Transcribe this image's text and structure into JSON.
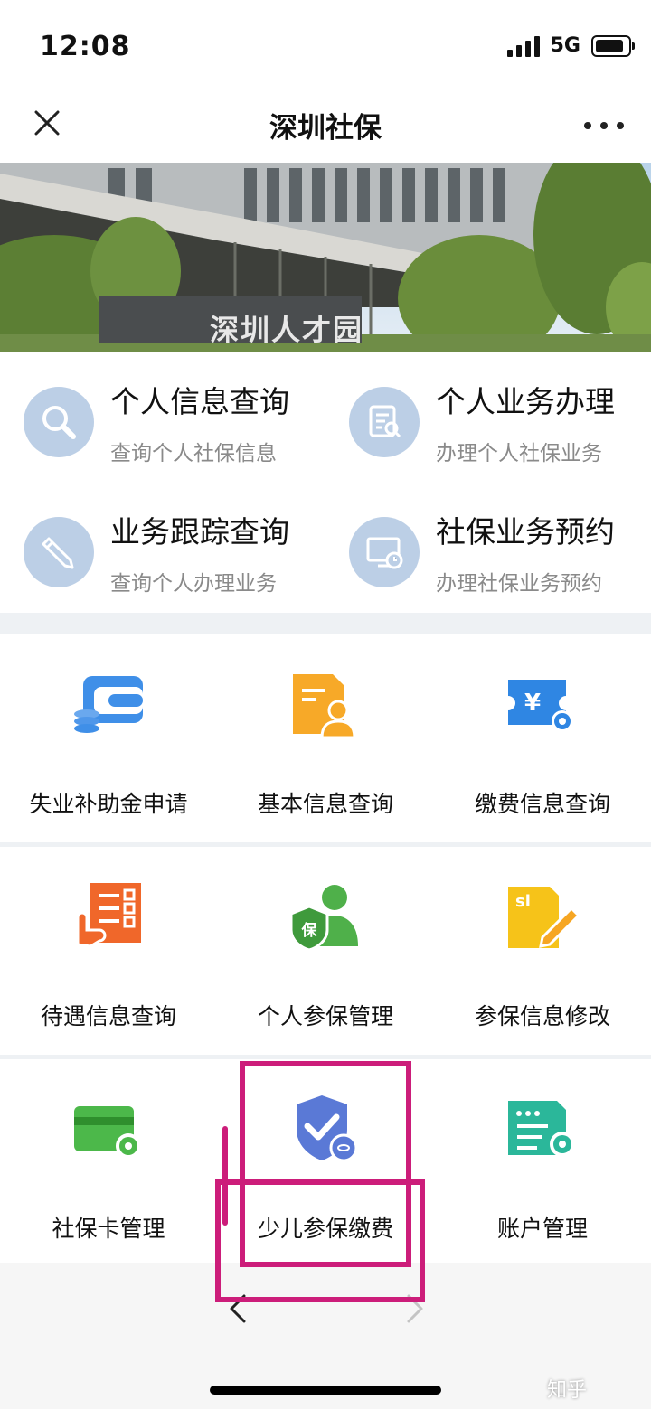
{
  "status": {
    "time": "12:08",
    "network": "5G"
  },
  "nav": {
    "title": "深圳社保",
    "close_icon": "close-icon",
    "more_icon": "more-dots-icon"
  },
  "banner": {
    "sign_text": "深圳人才园"
  },
  "quick_actions": [
    {
      "title": "个人信息查询",
      "subtitle": "查询个人社保信息",
      "icon": "search-icon"
    },
    {
      "title": "个人业务办理",
      "subtitle": "办理个人社保业务",
      "icon": "document-search-icon"
    },
    {
      "title": "业务跟踪查询",
      "subtitle": "查询个人办理业务",
      "icon": "pencil-icon"
    },
    {
      "title": "社保业务预约",
      "subtitle": "办理社保业务预约",
      "icon": "monitor-clock-icon"
    }
  ],
  "services": [
    {
      "label": "失业补助金申请",
      "icon": "wallet-coins-icon"
    },
    {
      "label": "基本信息查询",
      "icon": "person-document-icon"
    },
    {
      "label": "缴费信息查询",
      "icon": "yen-ticket-gear-icon"
    },
    {
      "label": "待遇信息查询",
      "icon": "hand-checklist-icon"
    },
    {
      "label": "个人参保管理",
      "icon": "person-shield-icon",
      "badge": "保"
    },
    {
      "label": "参保信息修改",
      "icon": "document-edit-icon",
      "badge": "si"
    },
    {
      "label": "社保卡管理",
      "icon": "card-gear-icon"
    },
    {
      "label": "少儿参保缴费",
      "icon": "shield-check-icon"
    },
    {
      "label": "账户管理",
      "icon": "list-gear-icon"
    }
  ],
  "colors": {
    "annotation": "#cc1d7a",
    "quick_icon_bg": "#bccfe6",
    "page_gap": "#eef1f4"
  },
  "watermark": "知乎"
}
